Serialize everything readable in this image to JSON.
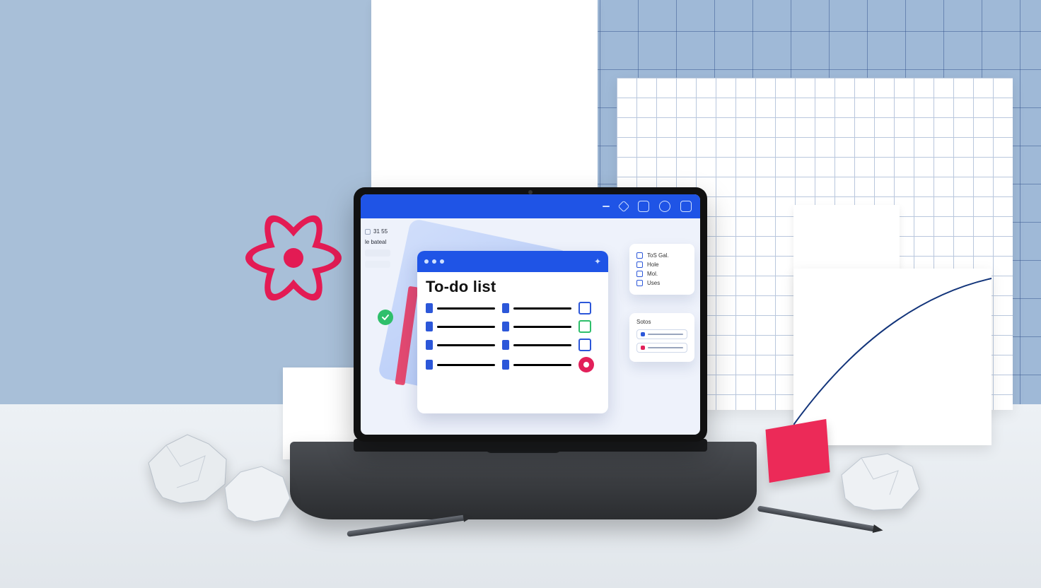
{
  "app": {
    "window_title": "To-do list"
  },
  "left_rail": {
    "line1": "31 55",
    "line2": "le bateal"
  },
  "nav_panel": {
    "items": [
      "ToS Gal.",
      "Hole",
      "Mol.",
      "Uses"
    ]
  },
  "selection_panel": {
    "header": "Sotos"
  },
  "colors": {
    "brand_blue": "#1f54e6",
    "accent_red": "#e2205a",
    "success_green": "#2fbf6b"
  }
}
